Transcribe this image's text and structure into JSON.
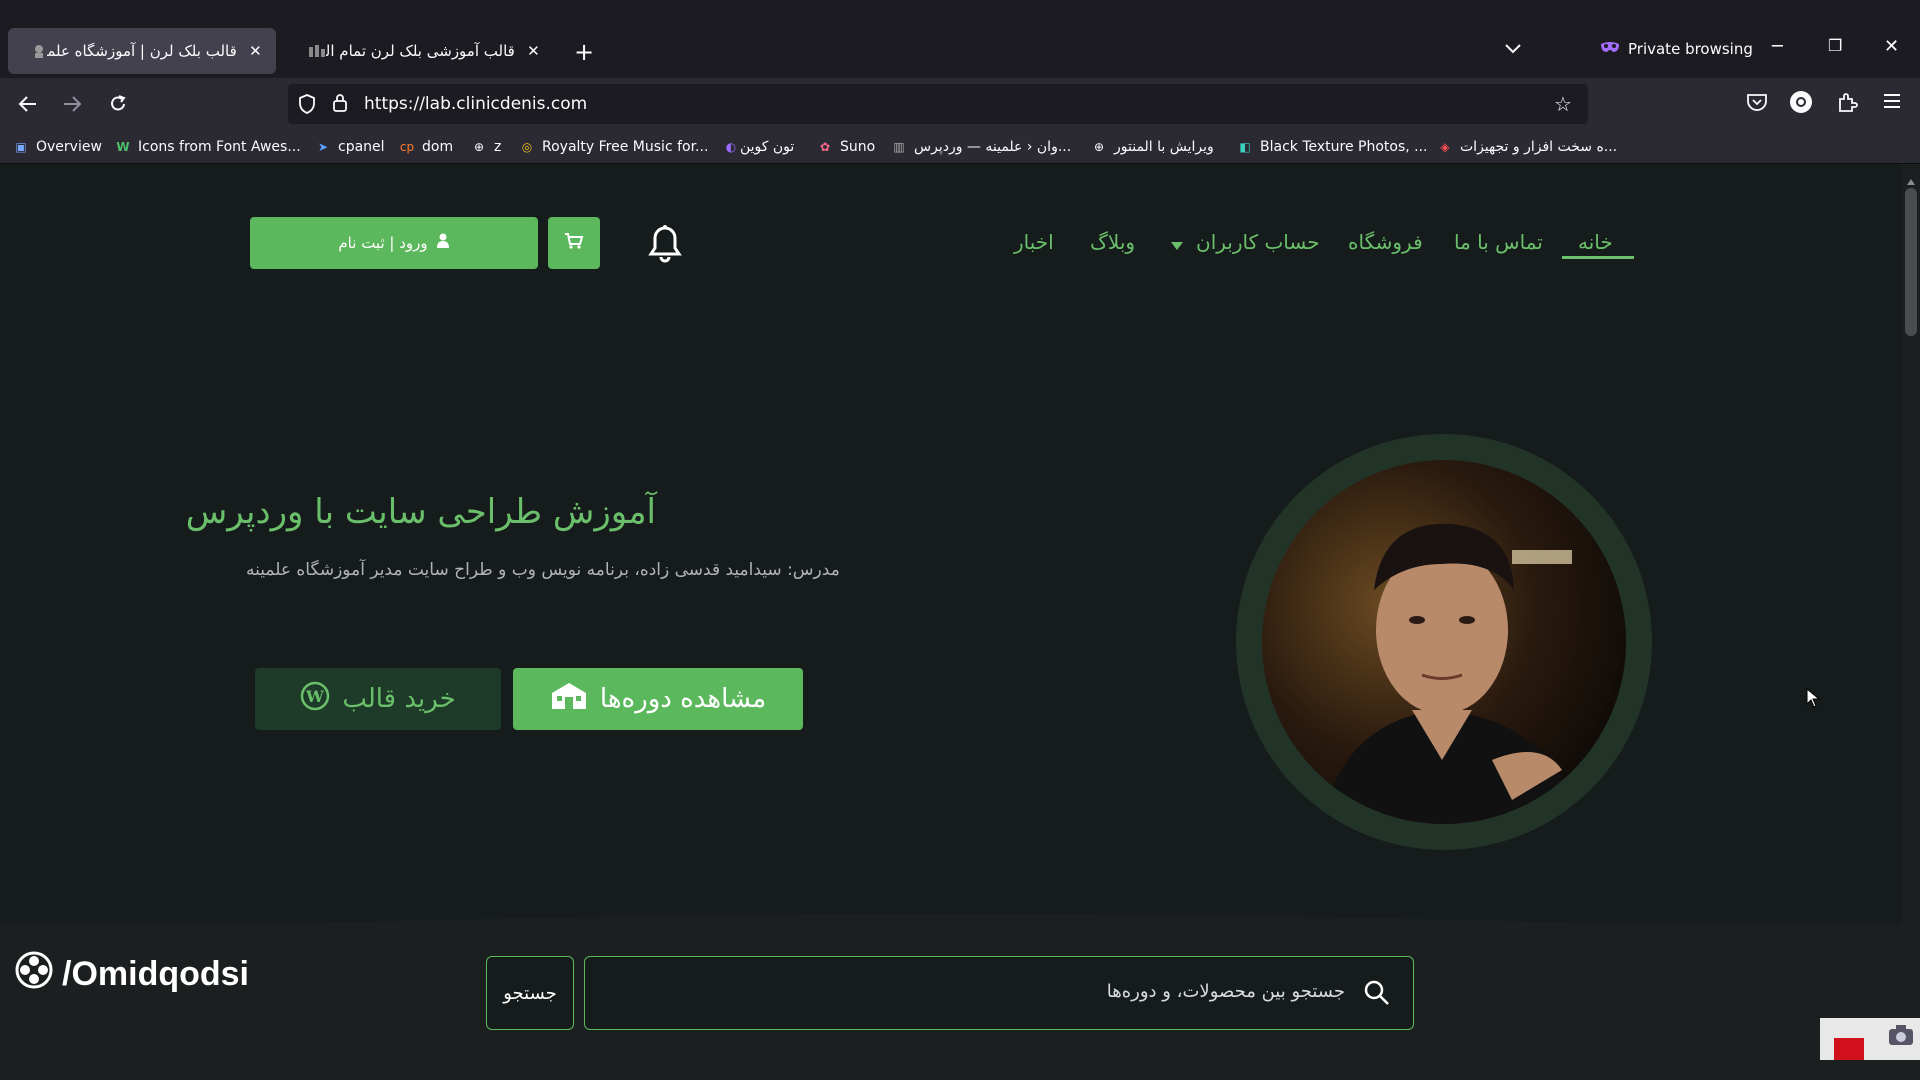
{
  "browser": {
    "tabs": [
      {
        "title": "قالب بلک لرن | آموزشگاه علمینه",
        "active": true
      },
      {
        "title": "قالب آموزشی بلک لرن تمام المنت",
        "active": false
      }
    ],
    "private_label": "Private browsing",
    "url": "https://lab.clinicdenis.com",
    "bookmarks": [
      {
        "label": "Overview",
        "icon": "overview-icon"
      },
      {
        "label": "Icons from Font Awes...",
        "icon": "fontawesome-icon"
      },
      {
        "label": "cpanel",
        "icon": "cpanel-icon"
      },
      {
        "label": "dom",
        "icon": "dom-icon"
      },
      {
        "label": "z",
        "icon": "globe-icon"
      },
      {
        "label": "Royalty Free Music for...",
        "icon": "music-icon"
      },
      {
        "label": "تون کوین",
        "icon": "toncoin-icon"
      },
      {
        "label": "Suno",
        "icon": "suno-icon"
      },
      {
        "label": "...وان ‹ علمینه — وردپرس",
        "icon": "wordpress-site-icon"
      },
      {
        "label": "ویرایش با المنتور",
        "icon": "globe-icon"
      },
      {
        "label": "Black Texture Photos, ...",
        "icon": "photos-icon"
      },
      {
        "label": "...ه سخت افزار و تجهیزات",
        "icon": "hardware-icon"
      }
    ]
  },
  "header": {
    "menu": [
      "خانه",
      "تماس با ما",
      "فروشگاه",
      "حساب کاربران",
      "وبلاگ",
      "اخبار"
    ],
    "login_label": "ورود | ثبت نام"
  },
  "hero": {
    "title": "آموزش طراحی سایت با وردپرس",
    "subtitle": "مدرس: سیدامید قدسی زاده، برنامه نویس وب و طراح سایت مدیر آموزشگاه علمینه",
    "courses_button": "مشاهده دوره‌ها",
    "buy_button": "خرید قالب"
  },
  "search": {
    "placeholder": "جستجو بین محصولات، و دوره‌ها",
    "button": "جستجو"
  },
  "watermark": "/Omidqodsi",
  "colors": {
    "accent": "#5cb85c",
    "accent_text": "#6abf6a",
    "page_bg": "#161b1c"
  }
}
